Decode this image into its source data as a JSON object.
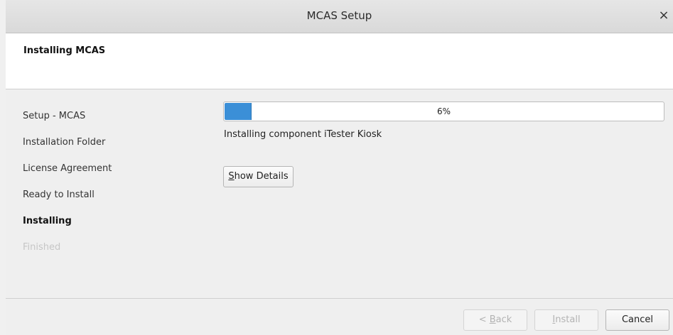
{
  "window": {
    "title": "MCAS Setup",
    "close_glyph": "×"
  },
  "header": {
    "title": "Installing MCAS"
  },
  "steps": [
    {
      "label": "Setup - MCAS",
      "state": "done"
    },
    {
      "label": "Installation Folder",
      "state": "done"
    },
    {
      "label": "License Agreement",
      "state": "done"
    },
    {
      "label": "Ready to Install",
      "state": "done"
    },
    {
      "label": "Installing",
      "state": "current"
    },
    {
      "label": "Finished",
      "state": "future"
    }
  ],
  "progress": {
    "percent": 6,
    "text": "6%"
  },
  "status": "Installing component iTester Kiosk",
  "details_button": {
    "mnemonic": "S",
    "rest": "how Details"
  },
  "buttons": {
    "back": {
      "prefix": "< ",
      "mnemonic": "B",
      "rest": "ack",
      "enabled": false
    },
    "install": {
      "mnemonic": "I",
      "rest": "nstall",
      "enabled": false
    },
    "cancel": {
      "label": "Cancel",
      "enabled": true
    }
  },
  "colors": {
    "accent": "#3b8fd7"
  }
}
